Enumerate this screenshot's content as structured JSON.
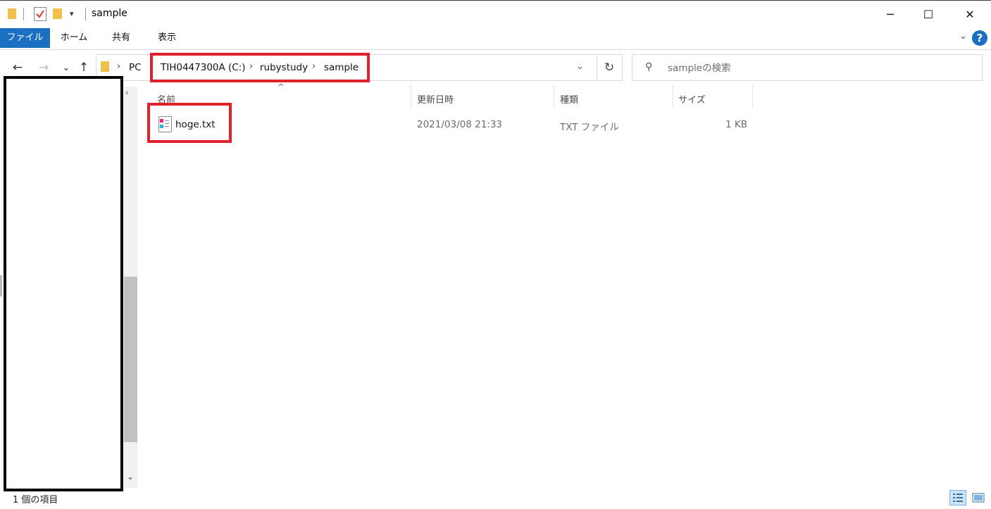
{
  "window": {
    "title": "sample",
    "minimize_glyph": "─",
    "maximize_glyph": "☐",
    "close_glyph": "✕"
  },
  "ribbon": {
    "tabs": [
      {
        "label": "ファイル"
      },
      {
        "label": "ホーム"
      },
      {
        "label": "共有"
      },
      {
        "label": "表示"
      }
    ],
    "help_label": "?"
  },
  "nav": {
    "back_glyph": "←",
    "forward_glyph": "→",
    "recent_glyph": "⌄",
    "up_glyph": "↑"
  },
  "breadcrumb": {
    "items": [
      {
        "label": "PC"
      },
      {
        "label": "TIH0447300A (C:)"
      },
      {
        "label": "rubystudy"
      },
      {
        "label": "sample"
      }
    ],
    "separator": "›"
  },
  "search": {
    "placeholder": "sampleの検索"
  },
  "columns": {
    "name": "名前",
    "modified": "更新日時",
    "type": "種類",
    "size": "サイズ"
  },
  "files": [
    {
      "name": "hoge.txt",
      "modified": "2021/03/08 21:33",
      "type": "TXT ファイル",
      "size": "1 KB"
    }
  ],
  "status": {
    "item_count": "1 個の項目"
  },
  "icons": {
    "quick_folder": "folder-icon",
    "properties": "checkmark-properties-icon",
    "new_folder": "new-folder-icon",
    "file": "text-file-icon",
    "search": "search-icon",
    "refresh": "refresh-icon"
  },
  "colors": {
    "accent": "#1a6fc2",
    "highlight_box": "#e1202c",
    "folder": "#f1c04a"
  }
}
